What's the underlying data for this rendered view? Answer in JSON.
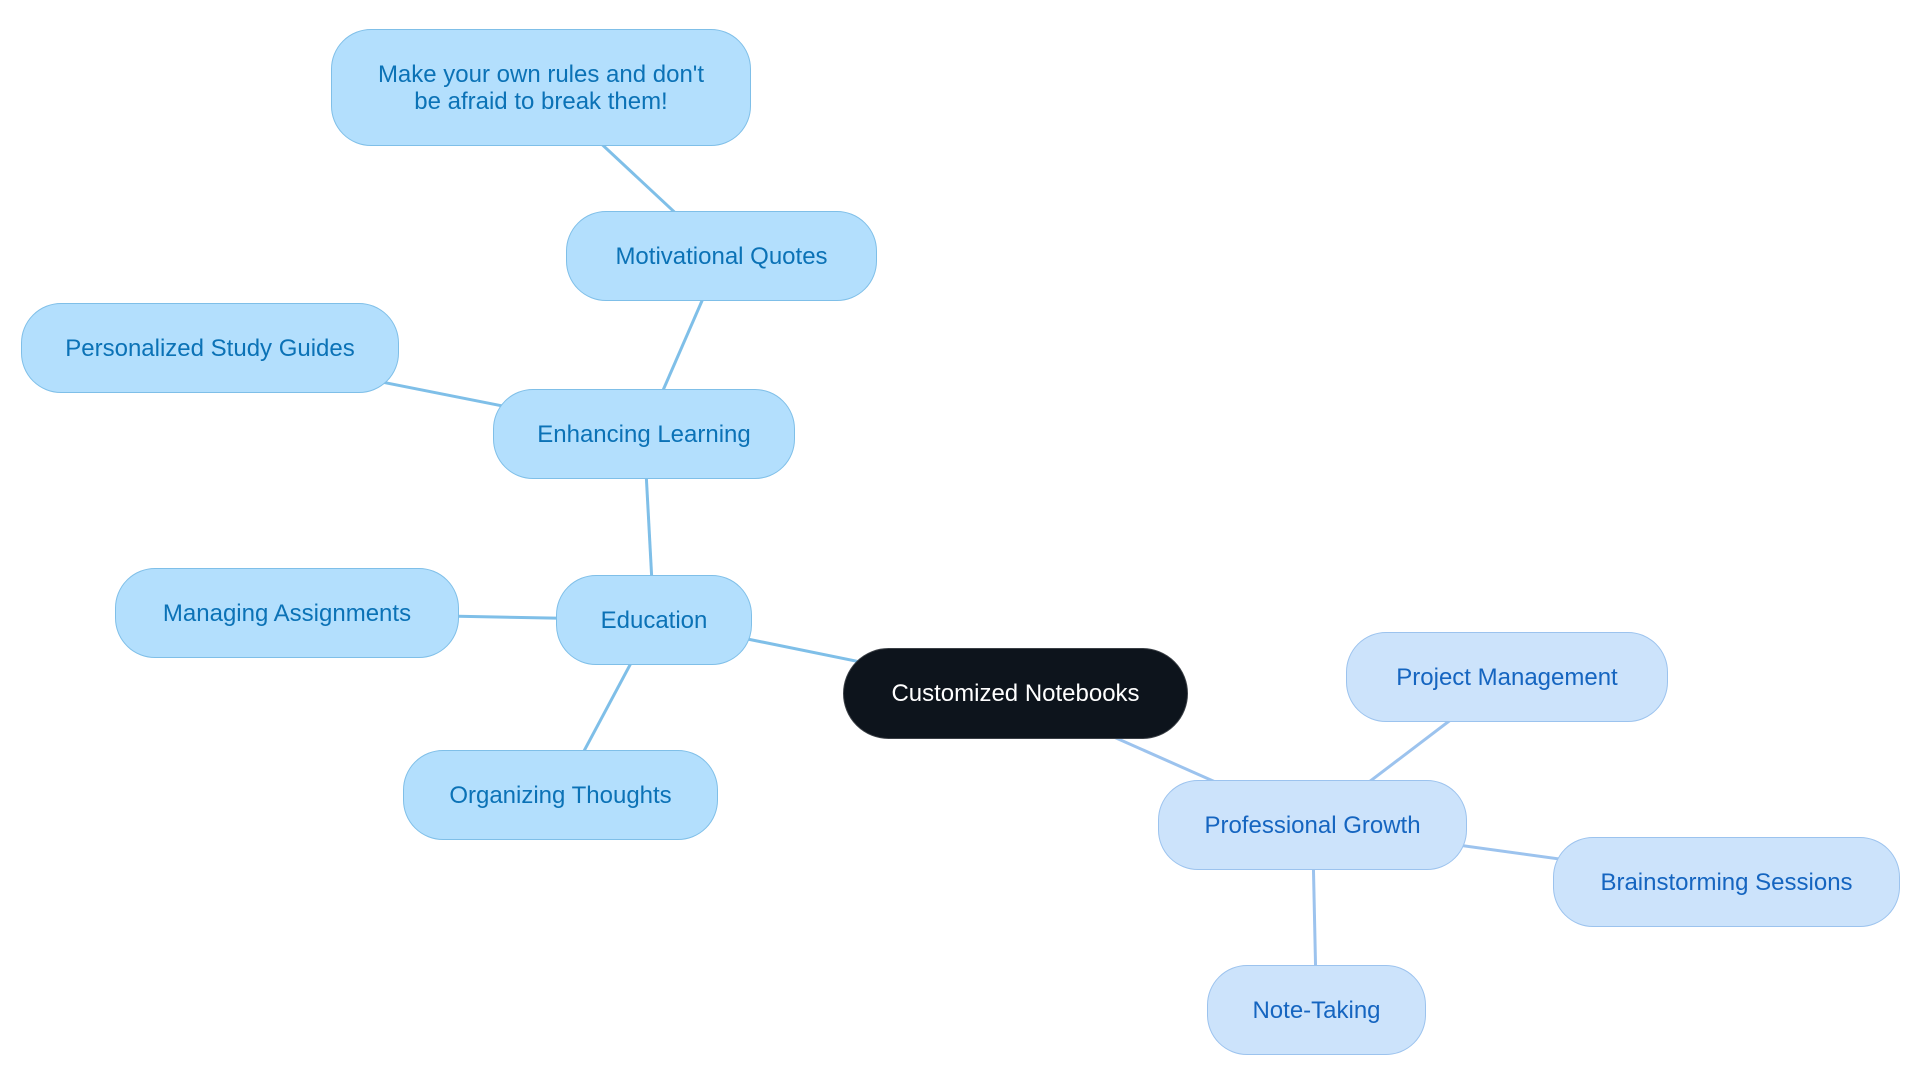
{
  "title": "Customized Notebooks",
  "colors": {
    "root_fill": "#0d141c",
    "root_text": "#ffffff",
    "education_fill": "#b3dffd",
    "education_text": "#0b72b6",
    "education_edge": "#7fbfe8",
    "professional_fill": "#cce3fb",
    "professional_text": "#1565c0",
    "professional_edge": "#9cc3ee"
  },
  "nodes": {
    "root": {
      "label": "Customized Notebooks"
    },
    "education": {
      "label": "Education"
    },
    "enhancing_learning": {
      "label": "Enhancing Learning"
    },
    "motivational_quotes": {
      "label": "Motivational Quotes"
    },
    "quote": {
      "label": "Make your own rules and don't be afraid to break them!"
    },
    "personalized_study_guides": {
      "label": "Personalized Study Guides"
    },
    "managing_assignments": {
      "label": "Managing Assignments"
    },
    "organizing_thoughts": {
      "label": "Organizing Thoughts"
    },
    "professional_growth": {
      "label": "Professional Growth"
    },
    "project_management": {
      "label": "Project Management"
    },
    "brainstorming_sessions": {
      "label": "Brainstorming Sessions"
    },
    "note_taking": {
      "label": "Note-Taking"
    }
  },
  "edges": [
    [
      "root",
      "education"
    ],
    [
      "education",
      "enhancing_learning"
    ],
    [
      "enhancing_learning",
      "motivational_quotes"
    ],
    [
      "motivational_quotes",
      "quote"
    ],
    [
      "enhancing_learning",
      "personalized_study_guides"
    ],
    [
      "education",
      "managing_assignments"
    ],
    [
      "education",
      "organizing_thoughts"
    ],
    [
      "root",
      "professional_growth"
    ],
    [
      "professional_growth",
      "project_management"
    ],
    [
      "professional_growth",
      "brainstorming_sessions"
    ],
    [
      "professional_growth",
      "note_taking"
    ]
  ]
}
